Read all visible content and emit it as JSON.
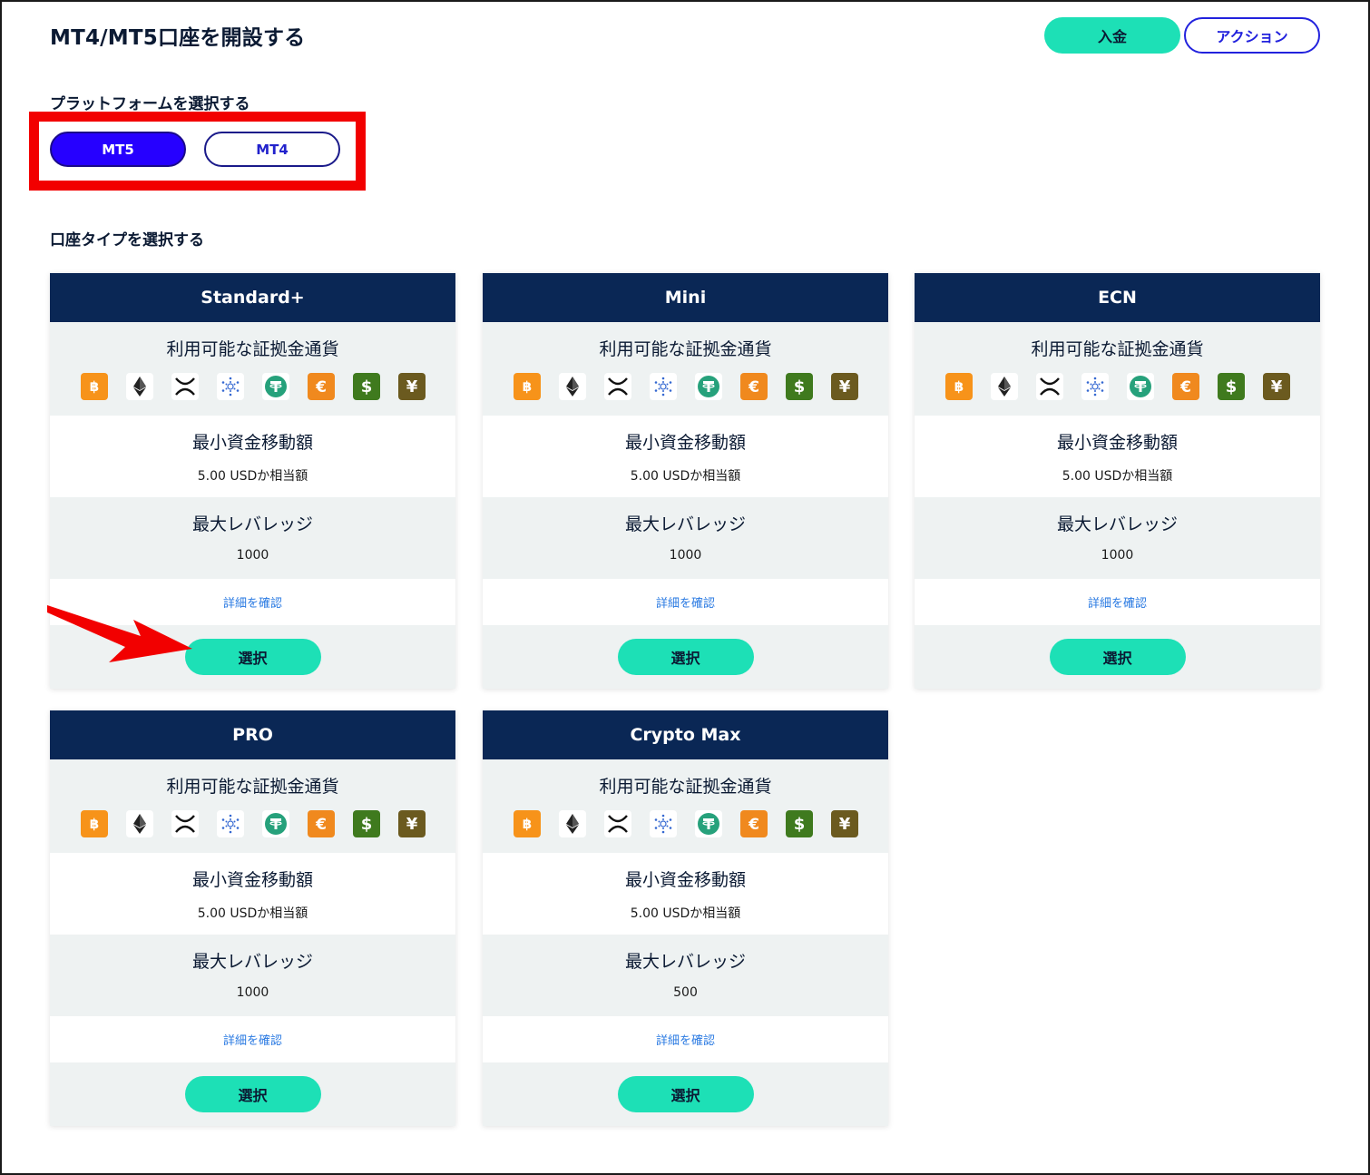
{
  "header": {
    "title": "MT4/MT5口座を開設する",
    "deposit_label": "入金",
    "action_label": "アクション"
  },
  "platform": {
    "label": "プラットフォームを選択する",
    "options": [
      "MT5",
      "MT4"
    ],
    "selected": "MT5"
  },
  "account_type": {
    "label": "口座タイプを選択する"
  },
  "colors": {
    "primary_dark": "#0a2755",
    "accent_green": "#1de0b6",
    "accent_blue": "#2600ff",
    "highlight_red": "#f20000"
  },
  "currency_icons": [
    "bitcoin-icon",
    "ethereum-icon",
    "xrp-icon",
    "cardano-icon",
    "tether-icon",
    "euro-icon",
    "dollar-icon",
    "yen-icon"
  ],
  "cards": [
    {
      "name": "Standard+",
      "currency_title": "利用可能な証拠金通貨",
      "min_title": "最小資金移動額",
      "min_value": "5.00 USDか相当額",
      "lev_title": "最大レバレッジ",
      "lev_value": "1000",
      "link": "詳細を確認",
      "select": "選択"
    },
    {
      "name": "Mini",
      "currency_title": "利用可能な証拠金通貨",
      "min_title": "最小資金移動額",
      "min_value": "5.00 USDか相当額",
      "lev_title": "最大レバレッジ",
      "lev_value": "1000",
      "link": "詳細を確認",
      "select": "選択"
    },
    {
      "name": "ECN",
      "currency_title": "利用可能な証拠金通貨",
      "min_title": "最小資金移動額",
      "min_value": "5.00 USDか相当額",
      "lev_title": "最大レバレッジ",
      "lev_value": "1000",
      "link": "詳細を確認",
      "select": "選択"
    },
    {
      "name": "PRO",
      "currency_title": "利用可能な証拠金通貨",
      "min_title": "最小資金移動額",
      "min_value": "5.00 USDか相当額",
      "lev_title": "最大レバレッジ",
      "lev_value": "1000",
      "link": "詳細を確認",
      "select": "選択"
    },
    {
      "name": "Crypto Max",
      "currency_title": "利用可能な証拠金通貨",
      "min_title": "最小資金移動額",
      "min_value": "5.00 USDか相当額",
      "lev_title": "最大レバレッジ",
      "lev_value": "500",
      "link": "詳細を確認",
      "select": "選択"
    }
  ]
}
